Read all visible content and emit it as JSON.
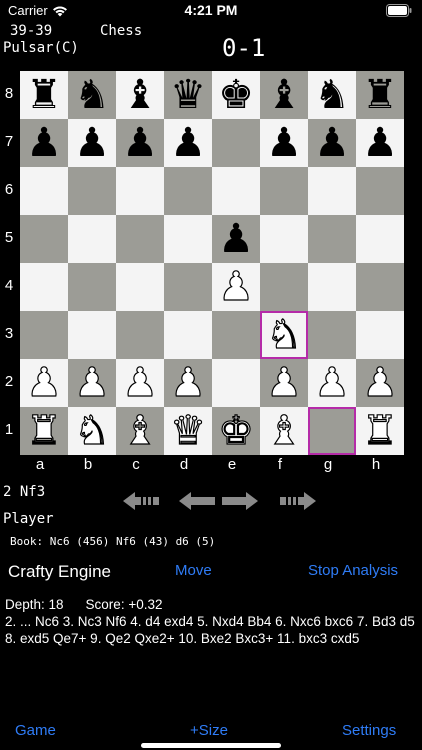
{
  "status_bar": {
    "carrier": "Carrier",
    "time": "4:21 PM"
  },
  "header": {
    "score": "39-39",
    "game_name": "Chess",
    "top_player": "Pulsar(C)",
    "result": "0-1"
  },
  "board": {
    "light_color": "#f4f4f4",
    "dark_color": "#9c9c96",
    "highlight_color": "#b52ba8",
    "files": [
      "a",
      "b",
      "c",
      "d",
      "e",
      "f",
      "g",
      "h"
    ],
    "ranks": [
      "8",
      "7",
      "6",
      "5",
      "4",
      "3",
      "2",
      "1"
    ],
    "pieces": [
      {
        "sq": "a8",
        "p": "r"
      },
      {
        "sq": "b8",
        "p": "n"
      },
      {
        "sq": "c8",
        "p": "b"
      },
      {
        "sq": "d8",
        "p": "q"
      },
      {
        "sq": "e8",
        "p": "k"
      },
      {
        "sq": "f8",
        "p": "b"
      },
      {
        "sq": "g8",
        "p": "n"
      },
      {
        "sq": "h8",
        "p": "r"
      },
      {
        "sq": "a7",
        "p": "p"
      },
      {
        "sq": "b7",
        "p": "p"
      },
      {
        "sq": "c7",
        "p": "p"
      },
      {
        "sq": "d7",
        "p": "p"
      },
      {
        "sq": "f7",
        "p": "p"
      },
      {
        "sq": "g7",
        "p": "p"
      },
      {
        "sq": "h7",
        "p": "p"
      },
      {
        "sq": "e5",
        "p": "p"
      },
      {
        "sq": "e4",
        "p": "P"
      },
      {
        "sq": "f3",
        "p": "N"
      },
      {
        "sq": "a2",
        "p": "P"
      },
      {
        "sq": "b2",
        "p": "P"
      },
      {
        "sq": "c2",
        "p": "P"
      },
      {
        "sq": "d2",
        "p": "P"
      },
      {
        "sq": "f2",
        "p": "P"
      },
      {
        "sq": "g2",
        "p": "P"
      },
      {
        "sq": "h2",
        "p": "P"
      },
      {
        "sq": "a1",
        "p": "R"
      },
      {
        "sq": "b1",
        "p": "N"
      },
      {
        "sq": "c1",
        "p": "B"
      },
      {
        "sq": "d1",
        "p": "Q"
      },
      {
        "sq": "e1",
        "p": "K"
      },
      {
        "sq": "f1",
        "p": "B"
      },
      {
        "sq": "h1",
        "p": "R"
      }
    ],
    "highlighted_squares": [
      "f3",
      "g1"
    ]
  },
  "info": {
    "last_move": "2 Nf3",
    "side_to_move": "Player",
    "book": "Book: Nc6 (456) Nf6 (43) d6 (5)"
  },
  "nav_icons": [
    "skip-to-start-icon",
    "step-back-icon",
    "step-forward-icon",
    "skip-to-end-icon"
  ],
  "engine": {
    "name": "Crafty Engine",
    "move_label": "Move",
    "stop_label": "Stop Analysis"
  },
  "analysis": {
    "depth": "Depth: 18",
    "score": "Score: +0.32",
    "line": "2. ... Nc6 3. Nc3 Nf6 4. d4 exd4 5. Nxd4 Bb4 6. Nxc6 bxc6 7. Bd3 d5 8. exd5 Qe7+ 9. Qe2 Qxe2+ 10. Bxe2 Bxc3+ 11. bxc3 cxd5"
  },
  "toolbar": {
    "game": "Game",
    "size": "+Size",
    "settings": "Settings"
  },
  "accent_color": "#2f7cf6"
}
